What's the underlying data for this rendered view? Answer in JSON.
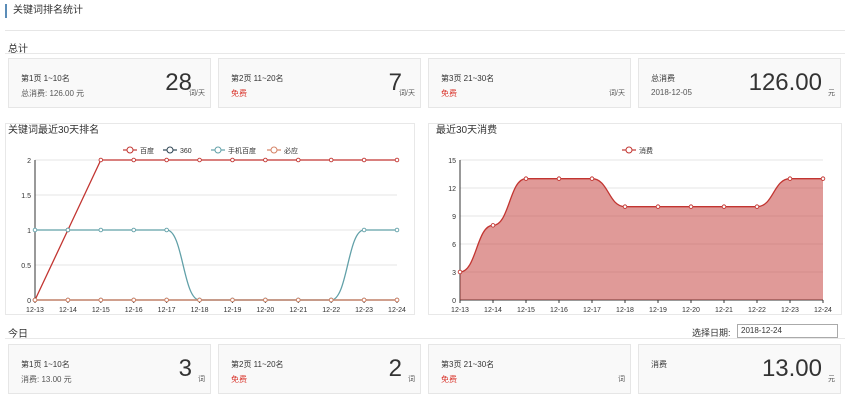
{
  "page": {
    "title": "关键词排名统计"
  },
  "summary": {
    "label": "总计",
    "cards": [
      {
        "label": "第1页 1~10名",
        "sub": "总消费: 126.00 元",
        "sub_red": false,
        "value": "28",
        "unit": "词/天"
      },
      {
        "label": "第2页 11~20名",
        "sub": "免费",
        "sub_red": true,
        "value": "7",
        "unit": "词/天"
      },
      {
        "label": "第3页 21~30名",
        "sub": "免费",
        "sub_red": true,
        "value": "",
        "unit": "词/天"
      },
      {
        "label": "总消费",
        "sub": "2018-12-05",
        "sub_red": false,
        "value": "126.00",
        "unit": "元"
      }
    ]
  },
  "today": {
    "label": "今日",
    "date_label": "选择日期:",
    "date_value": "2018-12-24",
    "cards": [
      {
        "label": "第1页 1~10名",
        "sub": "消费: 13.00 元",
        "sub_red": false,
        "value": "3",
        "unit": "词"
      },
      {
        "label": "第2页 11~20名",
        "sub": "免费",
        "sub_red": true,
        "value": "2",
        "unit": "词"
      },
      {
        "label": "第3页 21~30名",
        "sub": "免费",
        "sub_red": true,
        "value": "",
        "unit": "词"
      },
      {
        "label": "消费",
        "sub": "",
        "sub_red": false,
        "value": "13.00",
        "unit": "元"
      }
    ]
  },
  "chart_data": [
    {
      "type": "line",
      "title": "关键词最近30天排名",
      "x": [
        "12-13",
        "12-14",
        "12-15",
        "12-16",
        "12-17",
        "12-18",
        "12-19",
        "12-20",
        "12-21",
        "12-22",
        "12-23",
        "12-24"
      ],
      "ylim": [
        0,
        2
      ],
      "yticks": [
        "0",
        "0.5",
        "1",
        "1.5",
        "2"
      ],
      "grid": true,
      "legend_position": "top-center",
      "series": [
        {
          "name": "百度",
          "color": "#c23531",
          "values": [
            0,
            1,
            2,
            2,
            2,
            2,
            2,
            2,
            2,
            2,
            2,
            2
          ],
          "smooth": false
        },
        {
          "name": "360",
          "color": "#2f4554",
          "values": [
            0,
            0,
            0,
            0,
            0,
            0,
            0,
            0,
            0,
            0,
            0,
            0
          ],
          "smooth": false
        },
        {
          "name": "手机百度",
          "color": "#61a0a8",
          "values": [
            1,
            1,
            1,
            1,
            1,
            0,
            0,
            0,
            0,
            0,
            1,
            1
          ],
          "smooth": true
        },
        {
          "name": "必应",
          "color": "#d48265",
          "values": [
            0,
            0,
            0,
            0,
            0,
            0,
            0,
            0,
            0,
            0,
            0,
            0
          ],
          "smooth": false
        }
      ]
    },
    {
      "type": "area",
      "title": "最近30天消费",
      "x": [
        "12-13",
        "12-14",
        "12-15",
        "12-16",
        "12-17",
        "12-18",
        "12-19",
        "12-20",
        "12-21",
        "12-22",
        "12-23",
        "12-24"
      ],
      "ylim": [
        0,
        15
      ],
      "yticks": [
        "0",
        "3",
        "6",
        "9",
        "12",
        "15"
      ],
      "grid": true,
      "legend_position": "top-center",
      "series": [
        {
          "name": "消费",
          "color": "#c23531",
          "values": [
            3,
            8,
            13,
            13,
            13,
            10,
            10,
            10,
            10,
            10,
            13,
            13
          ],
          "smooth": true
        }
      ]
    }
  ]
}
